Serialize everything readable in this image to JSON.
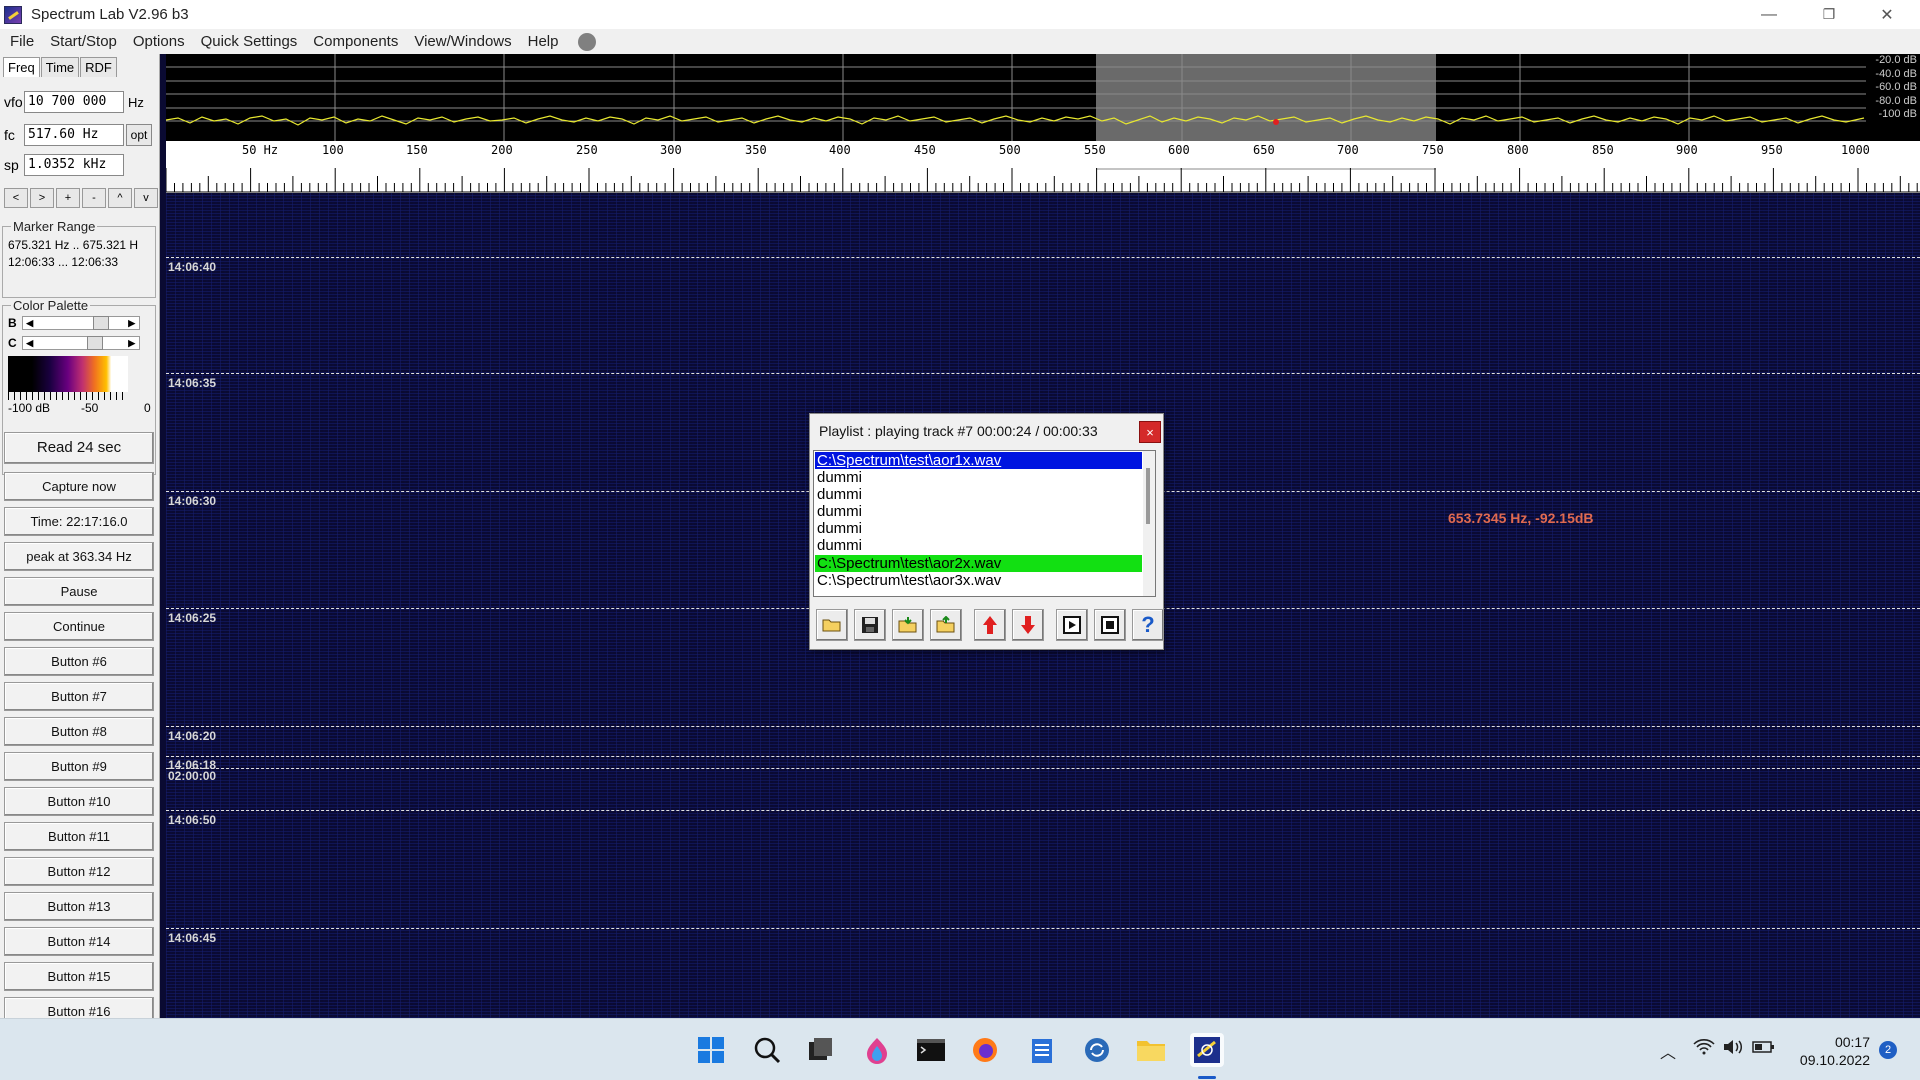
{
  "window": {
    "title": "Spectrum Lab V2.96 b3",
    "minimize": "—",
    "restore": "❐",
    "close": "✕"
  },
  "menu": [
    "File",
    "Start/Stop",
    "Options",
    "Quick Settings",
    "Components",
    "View/Windows",
    "Help"
  ],
  "left_panel": {
    "tabs": [
      "Freq",
      "Time",
      "RDF"
    ],
    "vfo": {
      "label": "vfo",
      "value": "10 700 000",
      "unit": "Hz"
    },
    "fc": {
      "label": "fc",
      "value": "517.60 Hz",
      "button": "opt"
    },
    "sp": {
      "label": "sp",
      "value": "1.0352 kHz"
    },
    "nav_buttons": [
      "<",
      ">",
      "+",
      "-",
      "^",
      "v"
    ],
    "marker_range": {
      "title": "Marker Range",
      "line1": "675.321 Hz .. 675.321 H",
      "line2": "12:06:33 ... 12:06:33"
    },
    "color_palette": {
      "title": "Color Palette",
      "b_label": "B",
      "c_label": "C",
      "scale_labels": [
        "-100 dB",
        "-50",
        "0"
      ]
    },
    "buttons": [
      "Read 24 sec",
      "Capture now",
      "Time:  22:17:16.0",
      "peak at 363.34 Hz",
      "Pause",
      "Continue",
      "Button #6",
      "Button #7",
      "Button #8",
      "Button #9",
      "Button #10",
      "Button #11",
      "Button #12",
      "Button #13",
      "Button #14",
      "Button #15",
      "Button #16"
    ]
  },
  "spectrum": {
    "db_labels": [
      "-20.0 dB",
      "-40.0 dB",
      "-60.0 dB",
      "-80.0 dB",
      "-100 dB"
    ]
  },
  "freq_scale": {
    "labels": [
      "50 Hz",
      "100",
      "150",
      "200",
      "250",
      "300",
      "350",
      "400",
      "450",
      "500",
      "550",
      "600",
      "650",
      "700",
      "750",
      "800",
      "850",
      "900",
      "950",
      "1000"
    ]
  },
  "waterfall": {
    "time_labels": [
      "14:06:40",
      "14:06:35",
      "14:06:30",
      "14:06:25",
      "14:06:20",
      "14:06:18",
      "02:00:00",
      "14:06:50",
      "14:06:45"
    ],
    "readout": "653.7345 Hz, -92.15dB"
  },
  "playlist": {
    "title": "Playlist : playing track #7 00:00:24 / 00:00:33",
    "close": "×",
    "items": [
      "C:\\Spectrum\\test\\aor1x.wav",
      "dummi",
      "dummi",
      "dummi",
      "dummi",
      "dummi",
      "C:\\Spectrum\\test\\aor2x.wav",
      "C:\\Spectrum\\test\\aor3x.wav"
    ],
    "selected_index": 0,
    "playing_index": 6,
    "toolbar": [
      "open-folder-icon",
      "save-icon",
      "load-icon",
      "export-icon",
      "move-up-icon",
      "move-down-icon",
      "play-track-icon",
      "stop-icon",
      "help-icon"
    ]
  },
  "taskbar": {
    "time": "00:17",
    "date": "09.10.2022",
    "notifications": "2"
  }
}
